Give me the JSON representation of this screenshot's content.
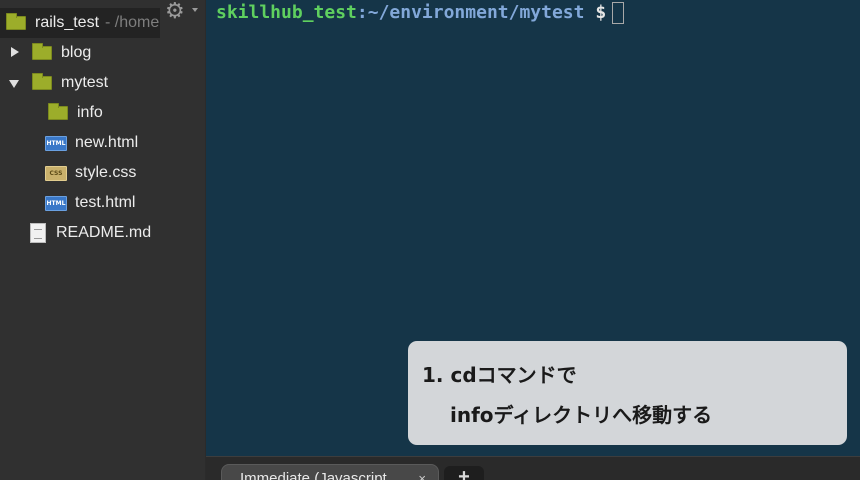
{
  "sidebar": {
    "root": {
      "name": "rails_test",
      "path": " - /home"
    },
    "items": [
      {
        "label": "blog"
      },
      {
        "label": "mytest"
      },
      {
        "label": "info"
      },
      {
        "label": "new.html",
        "badge": "HTML"
      },
      {
        "label": "style.css",
        "badge": "CSS"
      },
      {
        "label": "test.html",
        "badge": "HTML"
      },
      {
        "label": "README.md"
      }
    ]
  },
  "terminal": {
    "user": "skillhub_test",
    "separator": ":",
    "path": "~/environment/mytest",
    "symbol": "$"
  },
  "callout": {
    "line1": "1. cdコマンドで",
    "line2": "infoディレクトリへ移動する"
  },
  "tabs": {
    "active_label": "Immediate (Javascript",
    "close_symbol": "×",
    "add_symbol": "+"
  },
  "icons": {
    "gear": "gear-icon",
    "folder": "folder-icon",
    "html": "html-file-icon",
    "css": "css-file-icon",
    "doc": "document-icon"
  },
  "colors": {
    "terminal_bg": "#153548",
    "prompt_user": "#5fd05f",
    "prompt_path": "#82a8d9",
    "folder": "#9cad2a"
  }
}
